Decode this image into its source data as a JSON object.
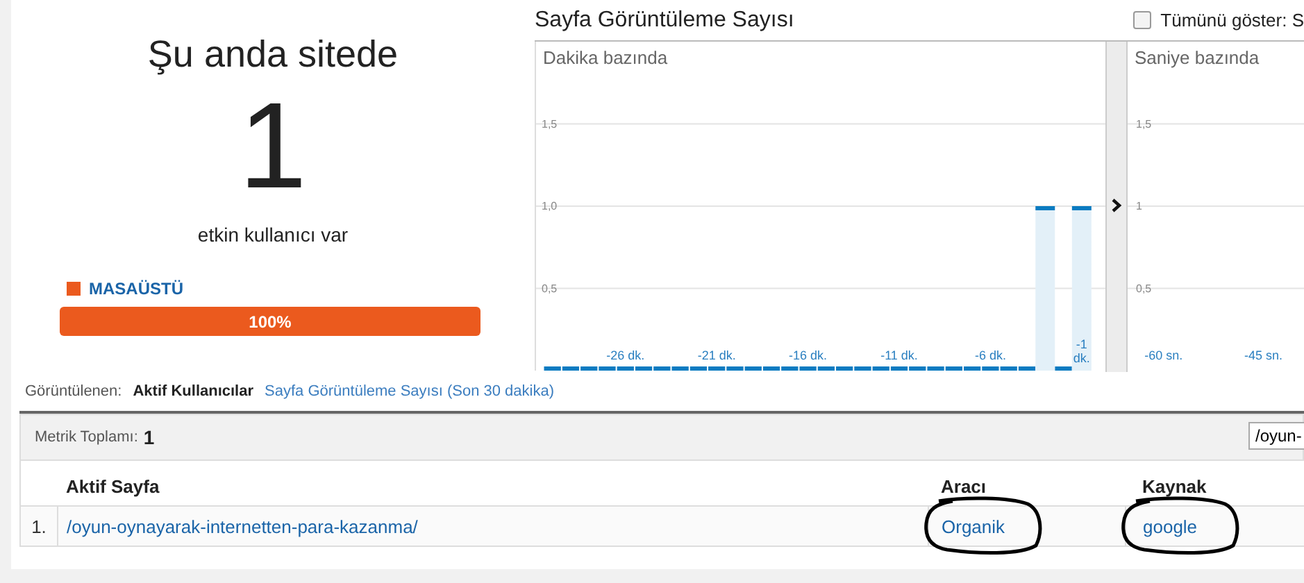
{
  "summary": {
    "title": "Şu anda sitede",
    "count": "1",
    "caption": "etkin kullanıcı var",
    "devices": [
      {
        "label": "MASAÜSTÜ",
        "color": "#eb5a1e",
        "level": 1,
        "percent": "100%"
      }
    ]
  },
  "chart_panel": {
    "title": "Sayfa Görüntüleme Sayısı",
    "show_all": {
      "label": "Tümünü göster: S",
      "checked": false
    },
    "minute_chart": {
      "chart_data": {
        "type": "bar",
        "title": "Dakika bazında",
        "grid": true,
        "x": [
          -30,
          -29,
          -28,
          -27,
          -26,
          -25,
          -24,
          -23,
          -22,
          -21,
          -20,
          -19,
          -18,
          -17,
          -16,
          -15,
          -14,
          -13,
          -12,
          -11,
          -10,
          -9,
          -8,
          -7,
          -6,
          -5,
          -4,
          -3,
          -2,
          -1
        ],
        "values": [
          0,
          0,
          0,
          0,
          0,
          0,
          0,
          0,
          0,
          0,
          0,
          0,
          0,
          0,
          0,
          0,
          0,
          0,
          0,
          0,
          0,
          0,
          0,
          0,
          0,
          0,
          0,
          1,
          0,
          1
        ],
        "xlim": [
          -30.9,
          0.3
        ],
        "ylim": [
          0,
          2
        ],
        "xticks": [
          {
            "value": -26,
            "label": "-26 dk."
          },
          {
            "value": -21,
            "label": "-21 dk."
          },
          {
            "value": -16,
            "label": "-16 dk."
          },
          {
            "value": -11,
            "label": "-11 dk."
          },
          {
            "value": -6,
            "label": "-6 dk."
          },
          {
            "value": -1,
            "label": "-1 dk."
          }
        ],
        "yticks": [
          {
            "value": 0.5,
            "label": "0,5"
          },
          {
            "value": 1,
            "label": "1,0"
          },
          {
            "value": 1.5,
            "label": "1,5"
          }
        ]
      }
    },
    "second_chart": {
      "chart_data": {
        "type": "bar",
        "title": "Saniye bazında",
        "grid": true,
        "xlim": [
          -65.4,
          -38.9
        ],
        "ylim": [
          0,
          2
        ],
        "xticks": [
          {
            "value": -60,
            "label": "-60 sn."
          },
          {
            "value": -45,
            "label": "-45 sn."
          }
        ],
        "yticks": [
          {
            "value": 0.5,
            "label": "0,5"
          },
          {
            "value": 1,
            "label": "1"
          },
          {
            "value": 1.5,
            "label": "1,5"
          }
        ]
      }
    }
  },
  "view_tabs": {
    "label": "Görüntülenen:",
    "tabs": [
      {
        "label": "Aktif Kullanıcılar",
        "selected": true
      },
      {
        "label": "Sayfa Görüntüleme Sayısı (Son 30 dakika)",
        "selected": false
      }
    ]
  },
  "table": {
    "metric_label": "Metrik Toplamı:",
    "metric_value": "1",
    "filter_value": "/oyun-",
    "columns": [
      "Aktif Sayfa",
      "Aracı",
      "Kaynak"
    ],
    "rows": [
      {
        "index": "1.",
        "cells": [
          "/oyun-oynayarak-internetten-para-kazanma/",
          "Organik",
          "google"
        ],
        "circled": [
          false,
          true,
          true
        ]
      }
    ]
  }
}
